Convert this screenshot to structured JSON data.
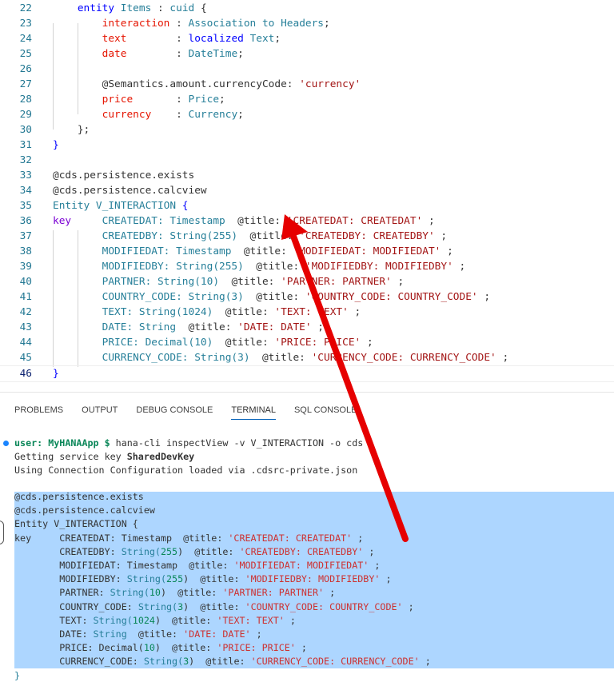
{
  "editor": {
    "lines": [
      {
        "n": "22",
        "t": [
          [
            "    ",
            "pl"
          ],
          [
            "entity",
            "kw"
          ],
          [
            " Items ",
            "ty"
          ],
          [
            ": ",
            "pl"
          ],
          [
            "cuid",
            "ty"
          ],
          [
            " {",
            "pl"
          ]
        ]
      },
      {
        "n": "23",
        "t": [
          [
            "        ",
            "pl"
          ],
          [
            "interaction",
            "pr"
          ],
          [
            " : ",
            "pl"
          ],
          [
            "Association to Headers",
            "ty"
          ],
          [
            ";",
            "pl"
          ]
        ]
      },
      {
        "n": "24",
        "t": [
          [
            "        ",
            "pl"
          ],
          [
            "text",
            "pr"
          ],
          [
            "        : ",
            "pl"
          ],
          [
            "localized",
            "kw"
          ],
          [
            " Text",
            "ty"
          ],
          [
            ";",
            "pl"
          ]
        ]
      },
      {
        "n": "25",
        "t": [
          [
            "        ",
            "pl"
          ],
          [
            "date",
            "pr"
          ],
          [
            "        : ",
            "pl"
          ],
          [
            "DateTime",
            "ty"
          ],
          [
            ";",
            "pl"
          ]
        ]
      },
      {
        "n": "26",
        "t": []
      },
      {
        "n": "27",
        "t": [
          [
            "        ",
            "pl"
          ],
          [
            "@Semantics.amount.currencyCode: ",
            "an"
          ],
          [
            "'currency'",
            "st"
          ]
        ]
      },
      {
        "n": "28",
        "t": [
          [
            "        ",
            "pl"
          ],
          [
            "price",
            "pr"
          ],
          [
            "       : ",
            "pl"
          ],
          [
            "Price",
            "ty"
          ],
          [
            ";",
            "pl"
          ]
        ]
      },
      {
        "n": "29",
        "t": [
          [
            "        ",
            "pl"
          ],
          [
            "currency",
            "pr"
          ],
          [
            "    : ",
            "pl"
          ],
          [
            "Currency",
            "ty"
          ],
          [
            ";",
            "pl"
          ]
        ]
      },
      {
        "n": "30",
        "t": [
          [
            "    ",
            "pl"
          ],
          [
            "};",
            "pl"
          ]
        ]
      },
      {
        "n": "31",
        "t": [
          [
            "}",
            "kw"
          ]
        ]
      },
      {
        "n": "32",
        "t": []
      },
      {
        "n": "33",
        "t": [
          [
            "@cds.persistence.exists",
            "an"
          ]
        ]
      },
      {
        "n": "34",
        "t": [
          [
            "@cds.persistence.calcview",
            "an"
          ]
        ]
      },
      {
        "n": "35",
        "t": [
          [
            "Entity V_INTERACTION ",
            "ty"
          ],
          [
            "{",
            "kw"
          ]
        ]
      },
      {
        "n": "36",
        "t": [
          [
            "key",
            "kp"
          ],
          [
            "     CREATEDAT: Timestamp  ",
            "ty"
          ],
          [
            "@title: ",
            "an"
          ],
          [
            "'CREATEDAT: CREATEDAT'",
            "st"
          ],
          [
            " ;",
            "pl"
          ]
        ]
      },
      {
        "n": "37",
        "t": [
          [
            "        CREATEDBY: String(255)  ",
            "ty"
          ],
          [
            "@title: ",
            "an"
          ],
          [
            "'CREATEDBY: CREATEDBY'",
            "st"
          ],
          [
            " ;",
            "pl"
          ]
        ]
      },
      {
        "n": "38",
        "t": [
          [
            "        MODIFIEDAT: Timestamp  ",
            "ty"
          ],
          [
            "@title: ",
            "an"
          ],
          [
            "'MODIFIEDAT: MODIFIEDAT'",
            "st"
          ],
          [
            " ;",
            "pl"
          ]
        ]
      },
      {
        "n": "39",
        "t": [
          [
            "        MODIFIEDBY: String(255)  ",
            "ty"
          ],
          [
            "@title: ",
            "an"
          ],
          [
            "'MODIFIEDBY: MODIFIEDBY'",
            "st"
          ],
          [
            " ;",
            "pl"
          ]
        ]
      },
      {
        "n": "40",
        "t": [
          [
            "        PARTNER: String(10)  ",
            "ty"
          ],
          [
            "@title: ",
            "an"
          ],
          [
            "'PARTNER: PARTNER'",
            "st"
          ],
          [
            " ;",
            "pl"
          ]
        ]
      },
      {
        "n": "41",
        "t": [
          [
            "        COUNTRY_CODE: String(3)  ",
            "ty"
          ],
          [
            "@title: ",
            "an"
          ],
          [
            "'COUNTRY_CODE: COUNTRY_CODE'",
            "st"
          ],
          [
            " ;",
            "pl"
          ]
        ]
      },
      {
        "n": "42",
        "t": [
          [
            "        TEXT: String(1024)  ",
            "ty"
          ],
          [
            "@title: ",
            "an"
          ],
          [
            "'TEXT: TEXT'",
            "st"
          ],
          [
            " ;",
            "pl"
          ]
        ]
      },
      {
        "n": "43",
        "t": [
          [
            "        DATE: String  ",
            "ty"
          ],
          [
            "@title: ",
            "an"
          ],
          [
            "'DATE: DATE'",
            "st"
          ],
          [
            " ;",
            "pl"
          ]
        ]
      },
      {
        "n": "44",
        "t": [
          [
            "        PRICE: Decimal(10)  ",
            "ty"
          ],
          [
            "@title: ",
            "an"
          ],
          [
            "'PRICE: PRICE'",
            "st"
          ],
          [
            " ;",
            "pl"
          ]
        ]
      },
      {
        "n": "45",
        "t": [
          [
            "        CURRENCY_CODE: String(3)  ",
            "ty"
          ],
          [
            "@title: ",
            "an"
          ],
          [
            "'CURRENCY_CODE: CURRENCY_CODE'",
            "st"
          ],
          [
            " ;",
            "pl"
          ]
        ]
      },
      {
        "n": "46",
        "t": [
          [
            "}",
            "kw"
          ]
        ]
      }
    ]
  },
  "panel": {
    "tabs": [
      "PROBLEMS",
      "OUTPUT",
      "DEBUG CONSOLE",
      "TERMINAL",
      "SQL CONSOLE"
    ],
    "active_tab": "TERMINAL"
  },
  "terminal": {
    "lines": [
      [
        [
          "user: MyHANAApp $ ",
          "tg"
        ],
        [
          "hana-cli inspectView -v V_INTERACTION -o cds",
          "tp"
        ]
      ],
      [
        [
          "Getting service key ",
          "tp"
        ],
        [
          "SharedDevKey",
          "tb"
        ]
      ],
      [
        [
          "Using Connection Configuration loaded via .cdsrc-private.json",
          "tp"
        ]
      ],
      [],
      [
        [
          "@cds.persistence.exists",
          "tp"
        ]
      ],
      [
        [
          "@cds.persistence.calcview",
          "tp"
        ]
      ],
      [
        [
          "Entity V_INTERACTION {",
          "tp"
        ]
      ],
      [
        [
          "key     CREATEDAT: Timestamp  @title: ",
          "tp"
        ],
        [
          "'CREATEDAT: CREATEDAT'",
          "ts"
        ],
        [
          " ;",
          "tp"
        ]
      ],
      [
        [
          "        CREATEDBY: ",
          "tp"
        ],
        [
          "String(",
          "tt"
        ],
        [
          "255",
          "tn"
        ],
        [
          ")  @title: ",
          "tp"
        ],
        [
          "'CREATEDBY: CREATEDBY'",
          "ts"
        ],
        [
          " ;",
          "tp"
        ]
      ],
      [
        [
          "        MODIFIEDAT: Timestamp  @title: ",
          "tp"
        ],
        [
          "'MODIFIEDAT: MODIFIEDAT'",
          "ts"
        ],
        [
          " ;",
          "tp"
        ]
      ],
      [
        [
          "        MODIFIEDBY: ",
          "tp"
        ],
        [
          "String(",
          "tt"
        ],
        [
          "255",
          "tn"
        ],
        [
          ")  @title: ",
          "tp"
        ],
        [
          "'MODIFIEDBY: MODIFIEDBY'",
          "ts"
        ],
        [
          " ;",
          "tp"
        ]
      ],
      [
        [
          "        PARTNER: ",
          "tp"
        ],
        [
          "String(",
          "tt"
        ],
        [
          "10",
          "tn"
        ],
        [
          ")  @title: ",
          "tp"
        ],
        [
          "'PARTNER: PARTNER'",
          "ts"
        ],
        [
          " ;",
          "tp"
        ]
      ],
      [
        [
          "        COUNTRY_CODE: ",
          "tp"
        ],
        [
          "String(",
          "tt"
        ],
        [
          "3",
          "tn"
        ],
        [
          ")  @title: ",
          "tp"
        ],
        [
          "'COUNTRY_CODE: COUNTRY_CODE'",
          "ts"
        ],
        [
          " ;",
          "tp"
        ]
      ],
      [
        [
          "        TEXT: ",
          "tp"
        ],
        [
          "String(",
          "tt"
        ],
        [
          "1024",
          "tn"
        ],
        [
          ")  @title: ",
          "tp"
        ],
        [
          "'TEXT: TEXT'",
          "ts"
        ],
        [
          " ;",
          "tp"
        ]
      ],
      [
        [
          "        DATE: ",
          "tp"
        ],
        [
          "String",
          "tt"
        ],
        [
          "  @title: ",
          "tp"
        ],
        [
          "'DATE: DATE'",
          "ts"
        ],
        [
          " ;",
          "tp"
        ]
      ],
      [
        [
          "        PRICE: Decimal(",
          "tp"
        ],
        [
          "10",
          "tn"
        ],
        [
          ")  @title: ",
          "tp"
        ],
        [
          "'PRICE: PRICE'",
          "ts"
        ],
        [
          " ;",
          "tp"
        ]
      ],
      [
        [
          "        CURRENCY_CODE: ",
          "tp"
        ],
        [
          "String(",
          "tt"
        ],
        [
          "3",
          "tn"
        ],
        [
          ")  @title: ",
          "tp"
        ],
        [
          "'CURRENCY_CODE: CURRENCY_CODE'",
          "ts"
        ],
        [
          " ;",
          "tp"
        ]
      ],
      [
        [
          "}",
          "tt"
        ]
      ]
    ]
  },
  "colors": {
    "arrow": "#e60000",
    "selection": "#add6ff",
    "accent": "#005fb8"
  }
}
